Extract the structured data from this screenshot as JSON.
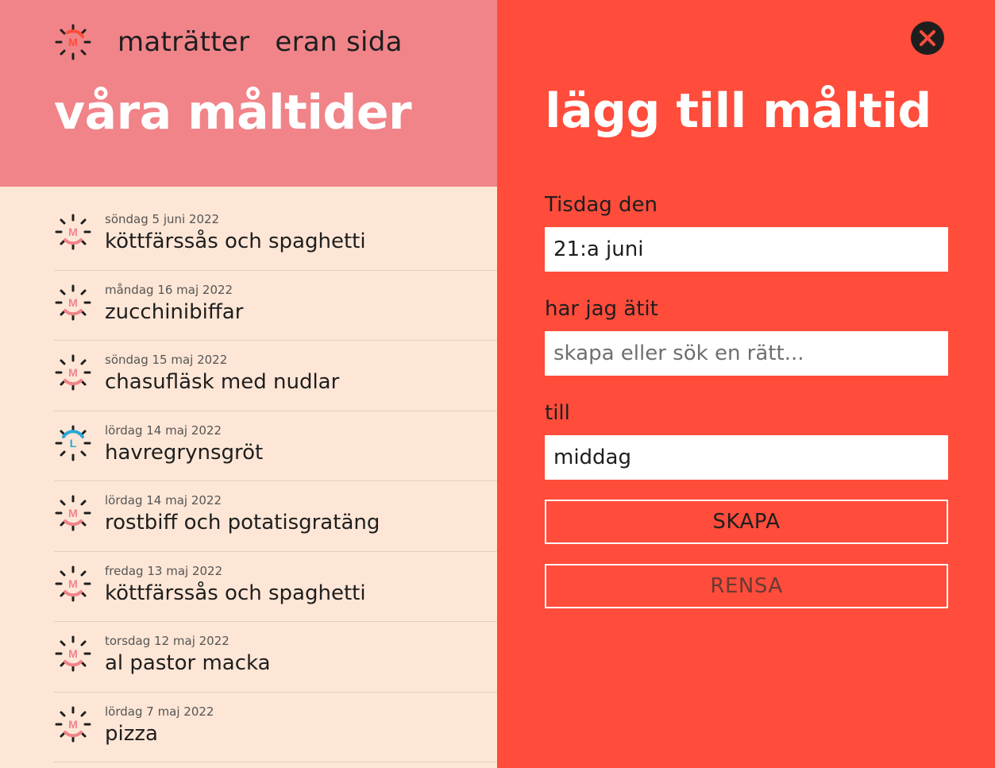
{
  "nav": {
    "logo_icon": "meal-badge-icon",
    "logo_letter": "M",
    "links": [
      "maträtter",
      "eran sida"
    ]
  },
  "left": {
    "title": "våra måltider",
    "meals": [
      {
        "date": "söndag 5 juni 2022",
        "name": "köttfärssås och spaghetti",
        "icon": "dinner-badge-icon",
        "type_letter": "M",
        "type_color": "#f08489"
      },
      {
        "date": "måndag 16 maj 2022",
        "name": "zucchinibiffar",
        "icon": "dinner-badge-icon",
        "type_letter": "M",
        "type_color": "#f08489"
      },
      {
        "date": "söndag 15 maj 2022",
        "name": "chasufläsk med nudlar",
        "icon": "dinner-badge-icon",
        "type_letter": "M",
        "type_color": "#f08489"
      },
      {
        "date": "lördag 14 maj 2022",
        "name": "havregrynsgröt",
        "icon": "lunch-badge-icon",
        "type_letter": "L",
        "type_color": "#2aa7d8"
      },
      {
        "date": "lördag 14 maj 2022",
        "name": "rostbiff och potatisgratäng",
        "icon": "dinner-badge-icon",
        "type_letter": "M",
        "type_color": "#f08489"
      },
      {
        "date": "fredag 13 maj 2022",
        "name": "köttfärssås och spaghetti",
        "icon": "dinner-badge-icon",
        "type_letter": "M",
        "type_color": "#f08489"
      },
      {
        "date": "torsdag 12 maj 2022",
        "name": "al pastor macka",
        "icon": "dinner-badge-icon",
        "type_letter": "M",
        "type_color": "#f08489"
      },
      {
        "date": "lördag 7 maj 2022",
        "name": "pizza",
        "icon": "dinner-badge-icon",
        "type_letter": "M",
        "type_color": "#f08489"
      }
    ]
  },
  "form": {
    "title": "lägg till måltid",
    "close_icon": "close-icon",
    "date_label": "Tisdag den",
    "date_value": "21:a juni",
    "meal_label": "har jag ätit",
    "meal_placeholder": "skapa eller sök en rätt...",
    "type_label": "till",
    "type_value": "middag",
    "create_label": "SKAPA",
    "clear_label": "RENSA"
  },
  "colors": {
    "left_header": "#f08489",
    "left_bg": "#fde6d6",
    "right_bg": "#ff4c3b",
    "dinner": "#f08489",
    "lunch": "#2aa7d8",
    "logo_accent": "#ff4c3b"
  }
}
